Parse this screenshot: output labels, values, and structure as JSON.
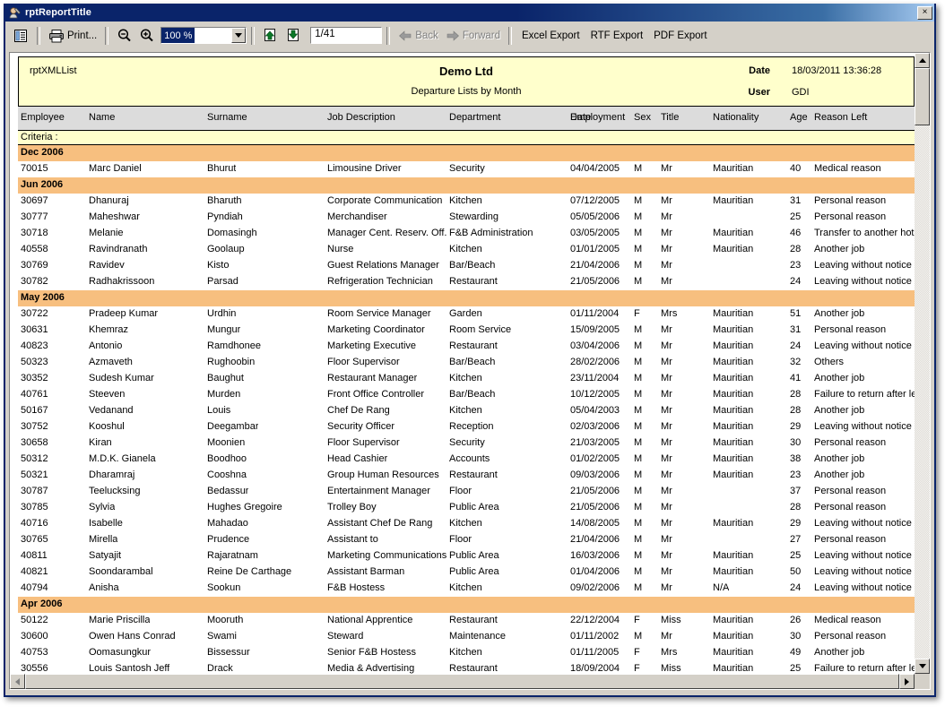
{
  "window": {
    "title": "rptReportTitle",
    "close_label": "×"
  },
  "toolbar": {
    "print_label": "Print...",
    "zoom_value": "100 %",
    "page_value": "1/41",
    "back_label": "Back",
    "forward_label": "Forward",
    "excel_export_label": "Excel Export",
    "rtf_export_label": "RTF Export",
    "pdf_export_label": "PDF Export"
  },
  "report": {
    "name": "rptXMLList",
    "company": "Demo Ltd",
    "subtitle": "Departure Lists by Month",
    "date_label": "Date",
    "date_value": "18/03/2011 13:36:28",
    "user_label": "User",
    "user_value": "GDI",
    "criteria_label": "Criteria :",
    "columns": [
      "Employee",
      "Name",
      "Surname",
      "Job Description",
      "Department",
      "Employment Date",
      "Sex",
      "Title",
      "Nationality",
      "Age",
      "Reason Left"
    ],
    "columns_split": {
      "employment_date_line1": "Employment",
      "employment_date_line2": "Date"
    },
    "groups": [
      {
        "label": "Dec 2006",
        "rows": [
          [
            "70015",
            "Marc Daniel",
            "Bhurut",
            "Limousine Driver",
            "Security",
            "04/04/2005",
            "M",
            "Mr",
            "Mauritian",
            "40",
            "Medical reason"
          ]
        ]
      },
      {
        "label": "Jun 2006",
        "rows": [
          [
            "30697",
            "Dhanuraj",
            "Bharuth",
            "Corporate Communication",
            "Kitchen",
            "07/12/2005",
            "M",
            "Mr",
            "Mauritian",
            "31",
            "Personal reason"
          ],
          [
            "30777",
            "Maheshwar",
            "Pyndiah",
            "Merchandiser",
            "Stewarding",
            "05/05/2006",
            "M",
            "Mr",
            "",
            "25",
            "Personal reason"
          ],
          [
            "30718",
            "Melanie",
            "Domasingh",
            "Manager Cent. Reserv. Off.",
            "F&B Administration",
            "03/05/2005",
            "M",
            "Mr",
            "Mauritian",
            "46",
            "Transfer to another hotel"
          ],
          [
            "40558",
            "Ravindranath",
            "Goolaup",
            "Nurse",
            "Kitchen",
            "01/01/2005",
            "M",
            "Mr",
            "Mauritian",
            "28",
            "Another job"
          ],
          [
            "30769",
            "Ravidev",
            "Kisto",
            "Guest Relations Manager",
            "Bar/Beach",
            "21/04/2006",
            "M",
            "Mr",
            "",
            "23",
            "Leaving without notice"
          ],
          [
            "30782",
            "Radhakrissoon",
            "Parsad",
            "Refrigeration Technician",
            "Restaurant",
            "21/05/2006",
            "M",
            "Mr",
            "",
            "24",
            "Leaving without notice"
          ]
        ]
      },
      {
        "label": "May 2006",
        "rows": [
          [
            "30722",
            "Pradeep Kumar",
            "Urdhin",
            "Room Service Manager",
            "Garden",
            "01/11/2004",
            "F",
            "Mrs",
            "Mauritian",
            "51",
            "Another job"
          ],
          [
            "30631",
            "Khemraz",
            "Mungur",
            "Marketing Coordinator",
            "Room Service",
            "15/09/2005",
            "M",
            "Mr",
            "Mauritian",
            "31",
            "Personal reason"
          ],
          [
            "40823",
            "Antonio",
            "Ramdhonee",
            "Marketing Executive",
            "Restaurant",
            "03/04/2006",
            "M",
            "Mr",
            "Mauritian",
            "24",
            "Leaving without notice"
          ],
          [
            "50323",
            "Azmaveth",
            "Rughoobin",
            "Floor Supervisor",
            "Bar/Beach",
            "28/02/2006",
            "M",
            "Mr",
            "Mauritian",
            "32",
            "Others"
          ],
          [
            "30352",
            "Sudesh Kumar",
            "Baughut",
            "Restaurant Manager",
            "Kitchen",
            "23/11/2004",
            "M",
            "Mr",
            "Mauritian",
            "41",
            "Another job"
          ],
          [
            "40761",
            "Steeven",
            "Murden",
            "Front Office Controller",
            "Bar/Beach",
            "10/12/2005",
            "M",
            "Mr",
            "Mauritian",
            "28",
            "Failure to return after leav"
          ],
          [
            "50167",
            "Vedanand",
            "Louis",
            "Chef De Rang",
            "Kitchen",
            "05/04/2003",
            "M",
            "Mr",
            "Mauritian",
            "28",
            "Another job"
          ],
          [
            "30752",
            "Kooshul",
            "Deegambar",
            "Security Officer",
            "Reception",
            "02/03/2006",
            "M",
            "Mr",
            "Mauritian",
            "29",
            "Leaving without notice"
          ],
          [
            "30658",
            "Kiran",
            "Moonien",
            "Floor Supervisor",
            "Security",
            "21/03/2005",
            "M",
            "Mr",
            "Mauritian",
            "30",
            "Personal reason"
          ],
          [
            "50312",
            "M.D.K. Gianela",
            "Boodhoo",
            "Head Cashier",
            "Accounts",
            "01/02/2005",
            "M",
            "Mr",
            "Mauritian",
            "38",
            "Another job"
          ],
          [
            "50321",
            "Dharamraj",
            "Cooshna",
            "Group Human Resources",
            "Restaurant",
            "09/03/2006",
            "M",
            "Mr",
            "Mauritian",
            "23",
            "Another job"
          ],
          [
            "30787",
            "Teelucksing",
            "Bedassur",
            "Entertainment Manager",
            "Floor",
            "21/05/2006",
            "M",
            "Mr",
            "",
            "37",
            "Personal reason"
          ],
          [
            "30785",
            "Sylvia",
            "Hughes Gregoire",
            "Trolley Boy",
            "Public Area",
            "21/05/2006",
            "M",
            "Mr",
            "",
            "28",
            "Personal reason"
          ],
          [
            "40716",
            "Isabelle",
            "Mahadao",
            "Assistant Chef De Rang",
            "Kitchen",
            "14/08/2005",
            "M",
            "Mr",
            "Mauritian",
            "29",
            "Leaving without notice"
          ],
          [
            "30765",
            "Mirella",
            "Prudence",
            "Assistant to",
            "Floor",
            "21/04/2006",
            "M",
            "Mr",
            "",
            "27",
            "Personal reason"
          ],
          [
            "40811",
            "Satyajit",
            "Rajaratnam",
            "Marketing Communications",
            "Public Area",
            "16/03/2006",
            "M",
            "Mr",
            "Mauritian",
            "25",
            "Leaving without notice"
          ],
          [
            "40821",
            "Soondarambal",
            "Reine De Carthage",
            "Assistant Barman",
            "Public Area",
            "01/04/2006",
            "M",
            "Mr",
            "Mauritian",
            "50",
            "Leaving without notice"
          ],
          [
            "40794",
            "Anisha",
            "Sookun",
            "F&B Hostess",
            "Kitchen",
            "09/02/2006",
            "M",
            "Mr",
            "N/A",
            "24",
            "Leaving without notice"
          ]
        ]
      },
      {
        "label": "Apr 2006",
        "rows": [
          [
            "50122",
            "Marie Priscilla",
            "Mooruth",
            "National Apprentice",
            "Restaurant",
            "22/12/2004",
            "F",
            "Miss",
            "Mauritian",
            "26",
            "Medical reason"
          ],
          [
            "30600",
            "Owen Hans Conrad",
            "Swami",
            "Steward",
            "Maintenance",
            "01/11/2002",
            "M",
            "Mr",
            "Mauritian",
            "30",
            "Personal reason"
          ],
          [
            "40753",
            "Oomasungkur",
            "Bissessur",
            "Senior F&B Hostess",
            "Kitchen",
            "01/11/2005",
            "F",
            "Mrs",
            "Mauritian",
            "49",
            "Another job"
          ],
          [
            "30556",
            "Louis Santosh Jeff",
            "Drack",
            "Media & Advertising",
            "Restaurant",
            "18/09/2004",
            "F",
            "Miss",
            "Mauritian",
            "25",
            "Failure to return after leav"
          ]
        ]
      }
    ]
  },
  "colors": {
    "titlebar": "#0a246a",
    "header_band": "#ffffcc",
    "group_band": "#f7bf7f",
    "column_header": "#dcdcdc",
    "chrome": "#d4d0c8"
  }
}
